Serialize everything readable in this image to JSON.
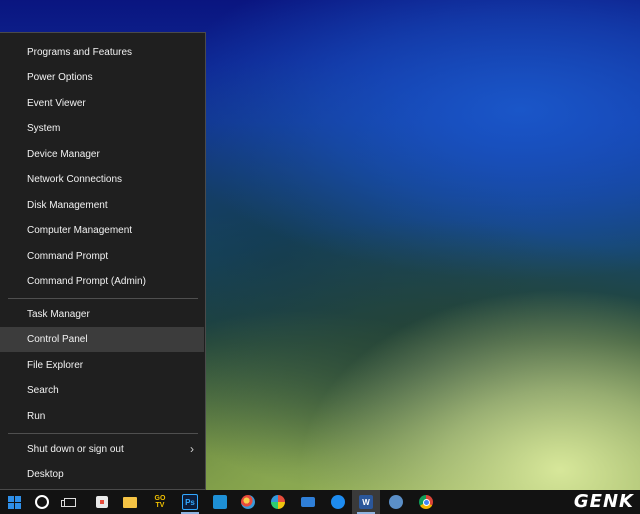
{
  "menu": {
    "items_top": [
      "Programs and Features",
      "Power Options",
      "Event Viewer",
      "System",
      "Device Manager",
      "Network Connections",
      "Disk Management",
      "Computer Management",
      "Command Prompt",
      "Command Prompt (Admin)"
    ],
    "items_mid": [
      "Task Manager",
      "Control Panel",
      "File Explorer",
      "Search",
      "Run"
    ],
    "items_bottom": [
      "Shut down or sign out",
      "Desktop"
    ],
    "highlighted": "Control Panel"
  },
  "taskbar": {
    "icons": [
      {
        "name": "start-icon"
      },
      {
        "name": "cortana-icon"
      },
      {
        "name": "task-view-icon"
      },
      {
        "name": "store-icon"
      },
      {
        "name": "file-explorer-icon"
      },
      {
        "name": "gotv-icon",
        "label": "GO TV"
      },
      {
        "name": "photoshop-icon",
        "label": "Ps"
      },
      {
        "name": "photos-icon"
      },
      {
        "name": "paint-icon"
      },
      {
        "name": "pinwheel-icon"
      },
      {
        "name": "mail-icon"
      },
      {
        "name": "messenger-icon"
      },
      {
        "name": "word-icon",
        "label": "W"
      },
      {
        "name": "network-app-icon"
      },
      {
        "name": "chrome-icon"
      }
    ]
  },
  "watermark": "GENK",
  "colors": {
    "menu_bg": "#1f1f1f",
    "menu_highlight": "#3c3c3c",
    "taskbar_bg": "#121212",
    "windows_blue": "#2f8fe8"
  }
}
